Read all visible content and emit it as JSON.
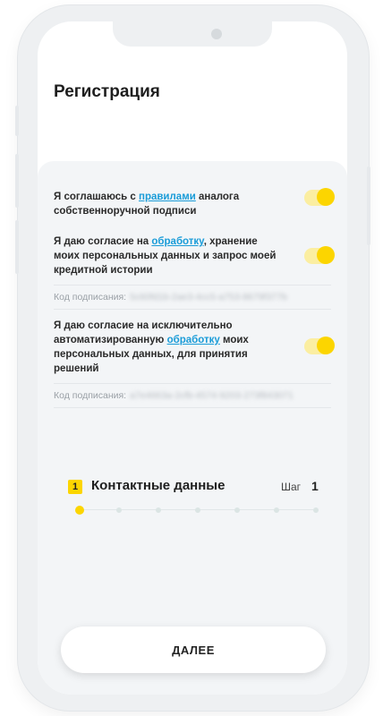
{
  "page": {
    "title": "Регистрация"
  },
  "consents": [
    {
      "pre": "Я соглашаюсь с ",
      "link": "правилами",
      "post": " аналога собственноручной подписи",
      "checked": true
    },
    {
      "pre": "Я даю согласие на ",
      "link": "обработку",
      "post": ", хранение моих персональных данных и запрос моей кредитной истории",
      "checked": true
    },
    {
      "pre": "Я даю согласие на исключительно автоматизированную ",
      "link": "обработку",
      "post": " моих персональных данных, для принятия решений",
      "checked": true
    }
  ],
  "signatures": [
    {
      "label": "Код подписания:",
      "code": "5c60fd1b-2ae3-4cc5-a753-8679f377b"
    },
    {
      "label": "Код подписания:",
      "code": "a7e4663a-2cfb-4574-9203-273f843071"
    }
  ],
  "step": {
    "badge": "1",
    "title": "Контактные данные",
    "word": "Шаг",
    "number": "1",
    "total_dots": 7,
    "current": 1
  },
  "actions": {
    "next_label": "ДАЛЕЕ"
  },
  "colors": {
    "accent": "#fcd500",
    "link": "#1a9cd8",
    "toggle_track": "#fbeea1"
  }
}
